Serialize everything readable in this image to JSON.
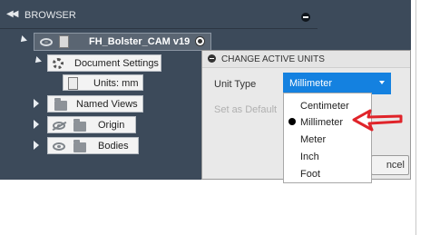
{
  "browser": {
    "collapse_icon": "double-chevron-left-icon",
    "title": "BROWSER"
  },
  "tree": {
    "root_label": "FH_Bolster_CAM v19",
    "document_settings_label": "Document Settings",
    "units_label": "Units: mm",
    "named_views_label": "Named Views",
    "origin_label": "Origin",
    "bodies_label": "Bodies"
  },
  "dialog": {
    "title": "CHANGE ACTIVE UNITS",
    "unit_type_label": "Unit Type",
    "unit_type_value": "Millimeter",
    "set_default_label": "Set as Default",
    "cancel_label": "ncel"
  },
  "dropdown": {
    "options": [
      "Centimeter",
      "Millimeter",
      "Meter",
      "Inch",
      "Foot"
    ],
    "selected": "Millimeter"
  },
  "colors": {
    "panel_bg": "#3c4a5a",
    "select_accent": "#1481e0",
    "annotation_red": "#e0242a"
  }
}
